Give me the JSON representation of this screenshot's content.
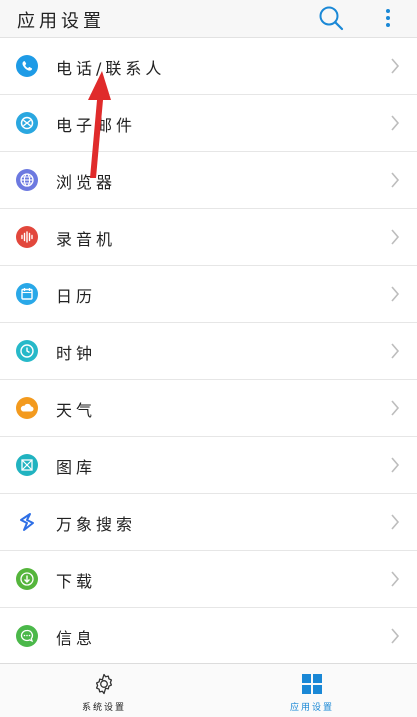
{
  "header": {
    "title": "应用设置",
    "search_icon": "search-icon",
    "more_icon": "more-vertical-icon"
  },
  "items": [
    {
      "label": "电话/联系人",
      "icon": "phone-icon",
      "color": "#1e9be6"
    },
    {
      "label": "电子邮件",
      "icon": "mail-icon",
      "color": "#2aa7e0"
    },
    {
      "label": "浏览器",
      "icon": "globe-icon",
      "color": "#6c79e0"
    },
    {
      "label": "录音机",
      "icon": "soundwave-icon",
      "color": "#e2473c"
    },
    {
      "label": "日历",
      "icon": "calendar-icon",
      "color": "#29a8e8"
    },
    {
      "label": "时钟",
      "icon": "clock-icon",
      "color": "#27b9c9"
    },
    {
      "label": "天气",
      "icon": "weather-icon",
      "color": "#f39a1e"
    },
    {
      "label": "图库",
      "icon": "gallery-icon",
      "color": "#21b3c0"
    },
    {
      "label": "万象搜索",
      "icon": "search-s-icon",
      "color": "#2e6fe6"
    },
    {
      "label": "下载",
      "icon": "download-icon",
      "color": "#55b53c"
    },
    {
      "label": "信息",
      "icon": "message-icon",
      "color": "#4bb84a"
    }
  ],
  "tabs": [
    {
      "label": "系统设置",
      "icon": "gear-icon",
      "active": false
    },
    {
      "label": "应用设置",
      "icon": "grid-icon",
      "active": true
    }
  ],
  "colors": {
    "accent": "#1a88d6",
    "annotation_arrow": "#e02b2b"
  }
}
